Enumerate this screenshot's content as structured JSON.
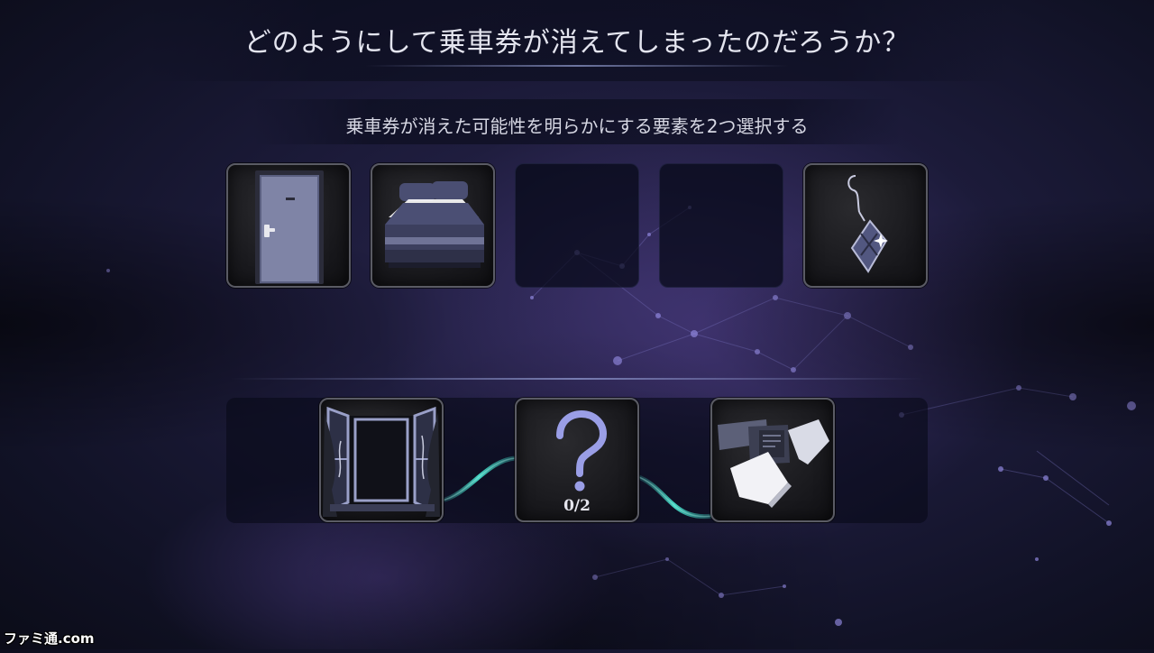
{
  "header": {
    "title": "どのようにして乗車券が消えてしまったのだろうか？",
    "instruction": "乗車券が消えた可能性を明らかにする要素を2つ選択する"
  },
  "evidence_cards": [
    {
      "slot": 1,
      "item": "door",
      "state": "filled"
    },
    {
      "slot": 2,
      "item": "bed",
      "state": "filled"
    },
    {
      "slot": 3,
      "item": "",
      "state": "empty"
    },
    {
      "slot": 4,
      "item": "",
      "state": "empty"
    },
    {
      "slot": 5,
      "item": "diamond-keychain",
      "state": "filled"
    }
  ],
  "deduction_chain": {
    "left_card": "open-window",
    "center_card": {
      "icon": "question-mark",
      "counter": "0/2"
    },
    "right_card": "scattered-papers"
  },
  "watermark": {
    "text": "ファミ通.com"
  },
  "colors": {
    "accent_blue": "#8f93d8",
    "link_teal": "#3fd0c0",
    "card_border": "#5a5b64",
    "question_mark": "#9a9ee6"
  }
}
